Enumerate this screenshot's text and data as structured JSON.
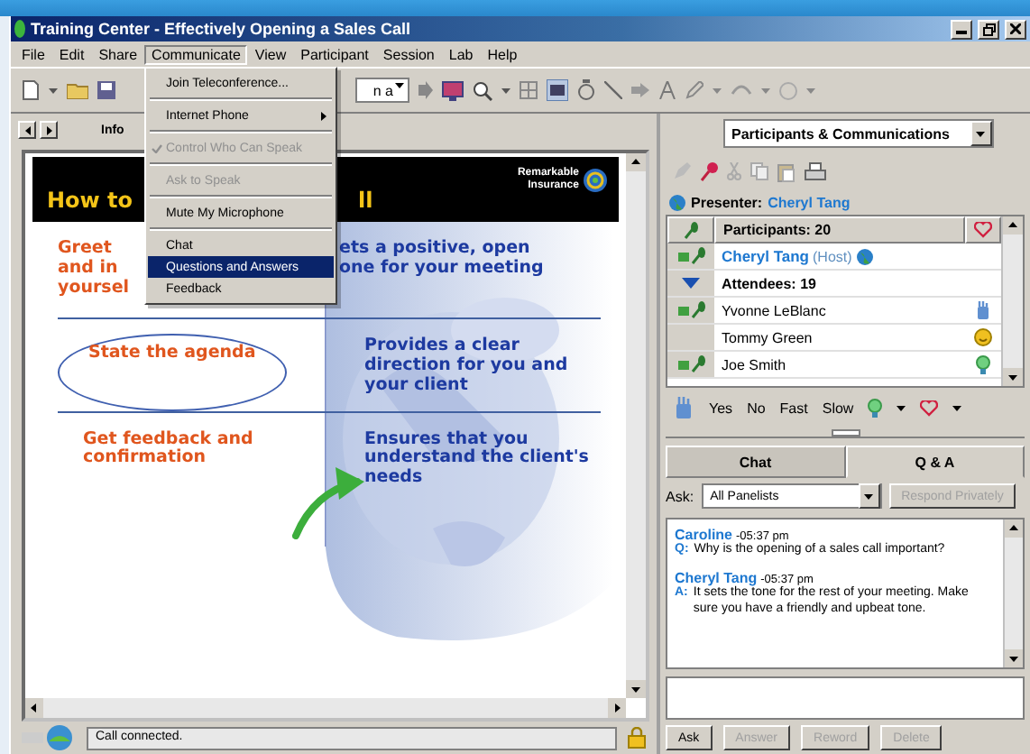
{
  "window": {
    "title": "Training Center - Effectively Opening a Sales Call"
  },
  "menu_bar": [
    {
      "label": "File",
      "selected": false
    },
    {
      "label": "Edit",
      "selected": false
    },
    {
      "label": "Share",
      "selected": false
    },
    {
      "label": "Communicate",
      "selected": true
    },
    {
      "label": "View",
      "selected": false
    },
    {
      "label": "Participant",
      "selected": false
    },
    {
      "label": "Session",
      "selected": false
    },
    {
      "label": "Lab",
      "selected": false
    },
    {
      "label": "Help",
      "selected": false
    }
  ],
  "open_menu": [
    {
      "kind": "item",
      "label": "Join Teleconference...",
      "disabled": false,
      "checked": false,
      "selected": false
    },
    {
      "kind": "separator"
    },
    {
      "kind": "submenu",
      "label": "Internet Phone",
      "disabled": false,
      "checked": false,
      "selected": false
    },
    {
      "kind": "separator"
    },
    {
      "kind": "item",
      "label": "Control Who Can Speak",
      "disabled": true,
      "checked": true,
      "selected": false
    },
    {
      "kind": "separator"
    },
    {
      "kind": "item",
      "label": "Ask to Speak",
      "disabled": true,
      "checked": false,
      "selected": false
    },
    {
      "kind": "separator"
    },
    {
      "kind": "item",
      "label": "Mute My Microphone",
      "disabled": false,
      "checked": false,
      "selected": false
    },
    {
      "kind": "separator"
    },
    {
      "kind": "item",
      "label": "Chat",
      "disabled": false,
      "checked": false,
      "selected": false
    },
    {
      "kind": "item",
      "label": "Questions and Answers",
      "disabled": false,
      "checked": false,
      "selected": true
    },
    {
      "kind": "item",
      "label": "Feedback",
      "disabled": false,
      "checked": false,
      "selected": false
    }
  ],
  "toolbar": {
    "field_value": "n a"
  },
  "slide_panel": {
    "tabs": [
      {
        "label": "Info",
        "selected": true
      }
    ],
    "slide": {
      "title_left": "How to",
      "title_right": "ll",
      "logo_text": "Remarkable\nInsurance",
      "rows": [
        {
          "left": "Greet\nand in\nyoursel",
          "right": "ets a positive, open\none for your meeting",
          "circled": false,
          "arrow": false
        },
        {
          "left": "State the agenda",
          "right": "Provides a clear\ndirection for you and\nyour client",
          "circled": true,
          "arrow": false
        },
        {
          "left": "Get feedback and\nconfirmation",
          "right": "Ensures that you\nunderstand the client's\nneeds",
          "circled": false,
          "arrow": true
        }
      ]
    }
  },
  "status_bar": {
    "message": "Call connected."
  },
  "right_panel": {
    "selector": "Participants & Communications",
    "presenter": {
      "label": "Presenter:",
      "name": "Cheryl Tang"
    },
    "participants": {
      "header": "Participants: 20",
      "host": {
        "name": "Cheryl Tang",
        "tag": "(Host)"
      },
      "group": {
        "label": "Attendees: 19",
        "expanded": true
      },
      "attendees": [
        {
          "name": "Yvonne LeBlanc",
          "mic": true,
          "kind": "hand"
        },
        {
          "name": "Tommy Green",
          "mic": false,
          "kind": "smile"
        },
        {
          "name": "Joe Smith",
          "mic": true,
          "kind": "bulb"
        }
      ]
    },
    "feedback_buttons": [
      "Yes",
      "No",
      "Fast",
      "Slow"
    ],
    "tabs": [
      {
        "label": "Chat",
        "selected": false
      },
      {
        "label": "Q & A",
        "selected": true
      }
    ],
    "ask_label": "Ask:",
    "recipient": "All Panelists",
    "respond": {
      "label": "Respond Privately",
      "disabled": true
    },
    "messages": [
      {
        "author": "Caroline",
        "time": "-05:37 pm",
        "prefix": "Q:",
        "text": "Why is the opening of a sales call important?"
      },
      {
        "author": "Cheryl Tang",
        "time": "-05:37 pm",
        "prefix": "A:",
        "text": "It sets the tone for the rest of your meeting. Make sure you have a friendly and upbeat tone."
      }
    ],
    "buttons": [
      {
        "label": "Ask",
        "disabled": false
      },
      {
        "label": "Answer",
        "disabled": true
      },
      {
        "label": "Reword",
        "disabled": true
      },
      {
        "label": "Delete",
        "disabled": true
      }
    ]
  }
}
